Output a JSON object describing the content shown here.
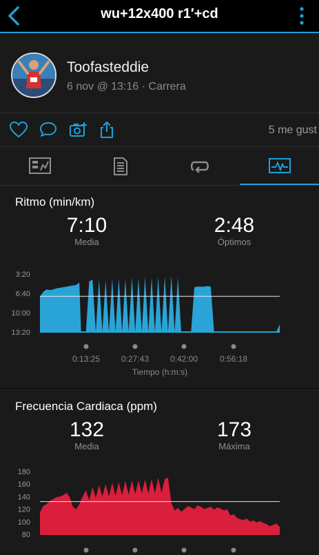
{
  "header": {
    "title": "wu+12x400 r1′+cd"
  },
  "activity": {
    "user": "Toofasteddie",
    "meta": "6 nov @ 13:16 · Carrera"
  },
  "social": {
    "likes": "5 me gust"
  },
  "colors": {
    "accent": "#1ea0d8",
    "pace": "#2aa4d6",
    "heart": "#d91f3b",
    "panel": "#1a1a1a"
  },
  "tabs": [
    {
      "icon": "stats-icon",
      "active": false
    },
    {
      "icon": "laps-icon",
      "active": false
    },
    {
      "icon": "splits-icon",
      "active": false
    },
    {
      "icon": "charts-icon",
      "active": true
    }
  ],
  "pace": {
    "title": "Ritmo (min/km)",
    "avg_value": "7:10",
    "avg_label": "Media",
    "best_value": "2:48",
    "best_label": "Óptimos",
    "xlabel": "Tiempo (h:m:s)"
  },
  "heart": {
    "title": "Frecuencia Cardiaca (ppm)",
    "avg_value": "132",
    "avg_label": "Media",
    "max_value": "173",
    "max_label": "Máxima"
  },
  "chart_data": [
    {
      "type": "area",
      "title": "Ritmo (min/km)",
      "ylabel": "min/km",
      "yticks": [
        "3:20",
        "6:40",
        "10:00",
        "13:20"
      ],
      "ylim": [
        13.33,
        3.33
      ],
      "reference_line": 7.17,
      "xlabel": "Tiempo (h:m:s)",
      "xticks": [
        "0:13:25",
        "0:27:43",
        "0:42:00",
        "0:56:18"
      ],
      "series": [
        {
          "x": [
            0,
            1,
            2,
            3,
            4,
            5,
            6,
            7,
            8,
            9,
            10,
            11,
            12,
            12.5,
            13,
            14,
            15,
            16,
            17,
            18,
            19,
            20,
            21,
            22,
            23,
            24,
            25,
            26,
            27,
            28,
            29,
            30,
            31,
            32,
            33,
            34,
            35,
            36,
            37,
            38,
            39,
            40,
            41,
            42,
            43,
            44,
            45,
            46,
            47,
            48,
            49,
            50,
            51,
            52,
            53,
            54,
            55,
            56,
            57,
            58,
            59,
            60,
            61,
            62,
            63,
            64,
            65,
            66,
            67,
            68,
            69,
            70,
            71,
            72,
            73
          ],
          "values": [
            7.2,
            6.4,
            6.0,
            6.1,
            6.0,
            5.8,
            5.7,
            5.6,
            5.5,
            5.4,
            5.3,
            5.2,
            4.8,
            13.3,
            13.3,
            13.3,
            4.6,
            4.3,
            13.3,
            4.2,
            13.3,
            4.3,
            13.3,
            4.1,
            13.3,
            4.0,
            13.3,
            4.2,
            13.3,
            3.9,
            13.3,
            4.0,
            13.3,
            3.8,
            13.3,
            3.9,
            13.3,
            3.8,
            13.3,
            3.7,
            13.3,
            3.6,
            13.3,
            3.9,
            13.3,
            13.3,
            13.3,
            13.3,
            5.6,
            5.5,
            5.5,
            5.5,
            5.4,
            5.5,
            13.3,
            13.3,
            13.3,
            13.3,
            13.3,
            13.3,
            13.3,
            13.3,
            13.3,
            13.3,
            13.3,
            13.3,
            13.3,
            13.3,
            13.3,
            13.3,
            13.3,
            13.3,
            13.3,
            13.3,
            12.0
          ]
        }
      ]
    },
    {
      "type": "area",
      "title": "Frecuencia Cardiaca (ppm)",
      "ylabel": "ppm",
      "yticks": [
        "180",
        "160",
        "140",
        "120",
        "100",
        "80"
      ],
      "ylim": [
        80,
        180
      ],
      "reference_line": 132,
      "series": [
        {
          "x": [
            0,
            1,
            2,
            3,
            4,
            5,
            6,
            7,
            8,
            9,
            10,
            11,
            12,
            13,
            14,
            15,
            16,
            17,
            18,
            19,
            20,
            21,
            22,
            23,
            24,
            25,
            26,
            27,
            28,
            29,
            30,
            31,
            32,
            33,
            34,
            35,
            36,
            37,
            38,
            39,
            40,
            41,
            42,
            43,
            44,
            45,
            46,
            47,
            48,
            49,
            50,
            51,
            52,
            53,
            54,
            55,
            56,
            57,
            58,
            59,
            60,
            61,
            62,
            63,
            64,
            65,
            66,
            67,
            68,
            69,
            70,
            71,
            72,
            73
          ],
          "values": [
            115,
            125,
            128,
            133,
            136,
            139,
            140,
            142,
            146,
            140,
            124,
            120,
            128,
            140,
            150,
            134,
            155,
            138,
            158,
            140,
            160,
            140,
            162,
            141,
            163,
            142,
            165,
            143,
            166,
            144,
            166,
            145,
            167,
            145,
            168,
            145,
            170,
            146,
            168,
            170,
            130,
            118,
            122,
            116,
            120,
            125,
            123,
            120,
            126,
            124,
            120,
            122,
            124,
            119,
            123,
            121,
            118,
            120,
            110,
            112,
            106,
            104,
            103,
            105,
            100,
            102,
            99,
            101,
            98,
            96,
            93,
            95,
            97,
            92
          ]
        }
      ]
    }
  ]
}
